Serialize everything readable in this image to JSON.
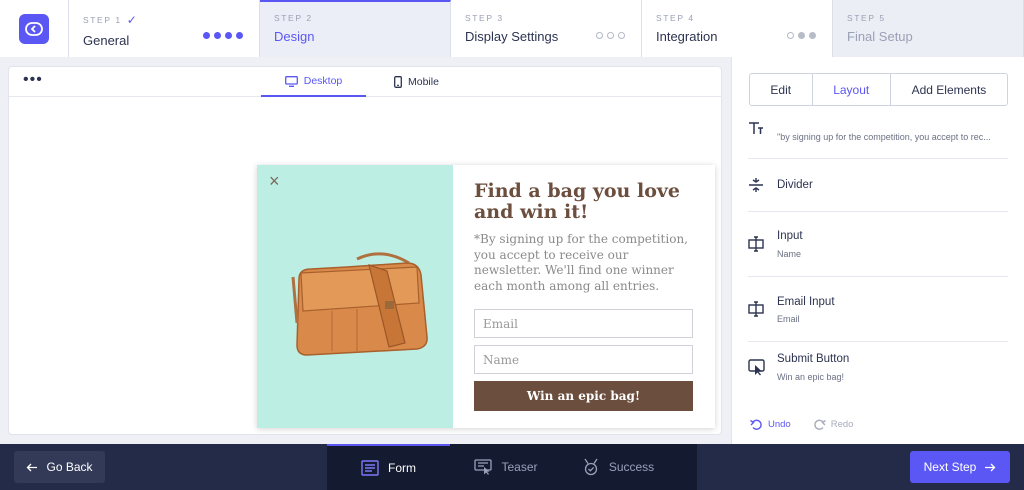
{
  "steps": [
    {
      "num": "STEP 1",
      "title": "General",
      "check": "✓"
    },
    {
      "num": "STEP 2",
      "title": "Design"
    },
    {
      "num": "STEP 3",
      "title": "Display Settings"
    },
    {
      "num": "STEP 4",
      "title": "Integration"
    },
    {
      "num": "STEP 5",
      "title": "Final Setup"
    }
  ],
  "canvas": {
    "more": "•••",
    "view_tabs": {
      "desktop": "Desktop",
      "mobile": "Mobile"
    }
  },
  "popup": {
    "close": "×",
    "headline": "Find a bag you love and win it!",
    "description": "*By signing up for the competition, you accept to receive our newsletter. We'll find one winner each month among all entries.",
    "email_placeholder": "Email",
    "name_placeholder": "Name",
    "button": "Win an epic bag!"
  },
  "panel": {
    "tabs": [
      "Edit",
      "Layout",
      "Add Elements"
    ],
    "elements": [
      {
        "icon": "text-icon",
        "title": "",
        "subtitle": "\"by signing up for the competition, you accept to rec..."
      },
      {
        "icon": "divider-icon",
        "title": "Divider",
        "subtitle": ""
      },
      {
        "icon": "input-icon",
        "title": "Input",
        "subtitle": "Name"
      },
      {
        "icon": "input-icon",
        "title": "Email Input",
        "subtitle": "Email"
      },
      {
        "icon": "button-icon",
        "title": "Submit Button",
        "subtitle": "Win an epic bag!"
      }
    ],
    "undo": "Undo",
    "redo": "Redo"
  },
  "bottom": {
    "go_back": "Go Back",
    "modes": [
      "Form",
      "Teaser",
      "Success"
    ],
    "next_step": "Next Step"
  },
  "colors": {
    "accent": "#5b57f5",
    "brown": "#6b4e3d",
    "mint": "#bdeee4",
    "navy": "#232b48"
  }
}
